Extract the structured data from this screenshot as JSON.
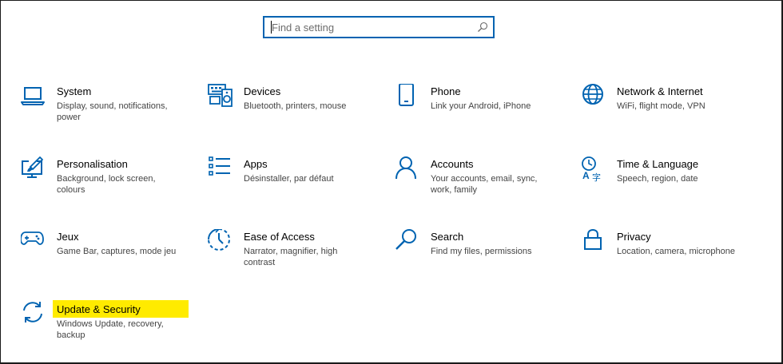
{
  "search": {
    "placeholder": "Find a setting",
    "value": ""
  },
  "accent_color": "#0063b1",
  "highlight_color": "#ffeb00",
  "tiles": [
    {
      "id": "system",
      "title": "System",
      "description": "Display, sound, notifications, power",
      "icon": "laptop-icon"
    },
    {
      "id": "devices",
      "title": "Devices",
      "description": "Bluetooth, printers, mouse",
      "icon": "keyboard-speaker-icon"
    },
    {
      "id": "phone",
      "title": "Phone",
      "description": "Link your Android, iPhone",
      "icon": "phone-icon"
    },
    {
      "id": "network",
      "title": "Network & Internet",
      "description": "WiFi, flight mode, VPN",
      "icon": "globe-icon"
    },
    {
      "id": "personalisation",
      "title": "Personalisation",
      "description": "Background, lock screen, colours",
      "icon": "paint-monitor-icon"
    },
    {
      "id": "apps",
      "title": "Apps",
      "description": "Désinstaller, par défaut",
      "icon": "apps-list-icon"
    },
    {
      "id": "accounts",
      "title": "Accounts",
      "description": "Your accounts, email, sync, work, family",
      "icon": "person-icon"
    },
    {
      "id": "time-language",
      "title": "Time & Language",
      "description": "Speech, region, date",
      "icon": "clock-language-icon"
    },
    {
      "id": "gaming",
      "title": "Jeux",
      "description": "Game Bar, captures, mode jeu",
      "icon": "gamepad-icon"
    },
    {
      "id": "ease-of-access",
      "title": "Ease of Access",
      "description": "Narrator, magnifier, high contrast",
      "icon": "ease-of-access-icon"
    },
    {
      "id": "search",
      "title": "Search",
      "description": "Find my files, permissions",
      "icon": "magnifier-icon"
    },
    {
      "id": "privacy",
      "title": "Privacy",
      "description": "Location, camera, microphone",
      "icon": "lock-icon"
    },
    {
      "id": "update-security",
      "title": "Update & Security",
      "description": "Windows Update, recovery, backup",
      "icon": "sync-arrows-icon"
    }
  ]
}
